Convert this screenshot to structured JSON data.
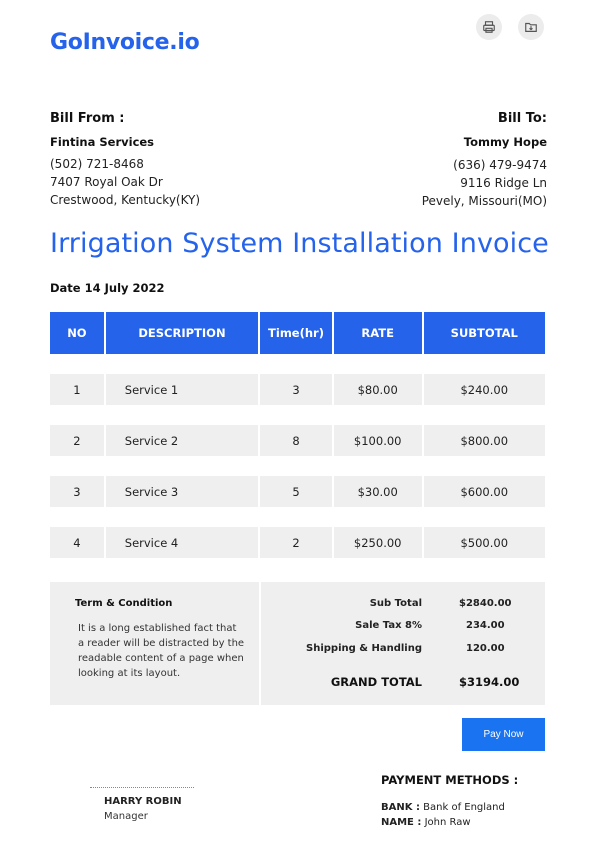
{
  "brand": "GoInvoice.io",
  "toolbar": {
    "print_icon": "printer-icon",
    "folder_icon": "folder-download-icon"
  },
  "bill_from": {
    "heading": "Bill From :",
    "company": "Fintina Services",
    "phone": "(502) 721-8468",
    "street": "7407 Royal Oak Dr",
    "city": "Crestwood, Kentucky(KY)"
  },
  "bill_to": {
    "heading": "Bill To:",
    "name": "Tommy Hope",
    "phone": "(636) 479-9474",
    "street": "9116 Ridge Ln",
    "city": "Pevely, Missouri(MO)"
  },
  "title": "Irrigation System Installation Invoice",
  "date": "Date 14 July 2022",
  "table": {
    "headers": [
      "NO",
      "DESCRIPTION",
      "Time(hr)",
      "RATE",
      "SUBTOTAL"
    ],
    "rows": [
      [
        "1",
        "Service 1",
        "3",
        "$80.00",
        "$240.00"
      ],
      [
        "2",
        "Service 2",
        "8",
        "$100.00",
        "$800.00"
      ],
      [
        "3",
        "Service 3",
        "5",
        "$30.00",
        "$600.00"
      ],
      [
        "4",
        "Service 4",
        "2",
        "$250.00",
        "$500.00"
      ]
    ]
  },
  "terms": {
    "title": "Term & Condition",
    "text": "It is a long established fact that a reader will be distracted by the readable content of a page when looking at its layout."
  },
  "totals": {
    "subtotal_label": "Sub Total",
    "subtotal_value": "$2840.00",
    "tax_label": "Sale Tax 8%",
    "tax_value": "234.00",
    "shipping_label": "Shipping & Handling",
    "shipping_value": "120.00",
    "grand_label": "GRAND TOTAL",
    "grand_value": "$3194.00"
  },
  "pay_button": "Pay Now",
  "signature": {
    "name": "HARRY ROBIN",
    "role": "Manager"
  },
  "payment": {
    "title": "PAYMENT METHODS :",
    "bank_label": "BANK :",
    "bank_value": "Bank of England",
    "name_label": "NAME :",
    "name_value": "John Raw"
  },
  "colors": {
    "accent": "#2563EB",
    "button": "#1a73f0",
    "row_bg": "#efefef"
  }
}
